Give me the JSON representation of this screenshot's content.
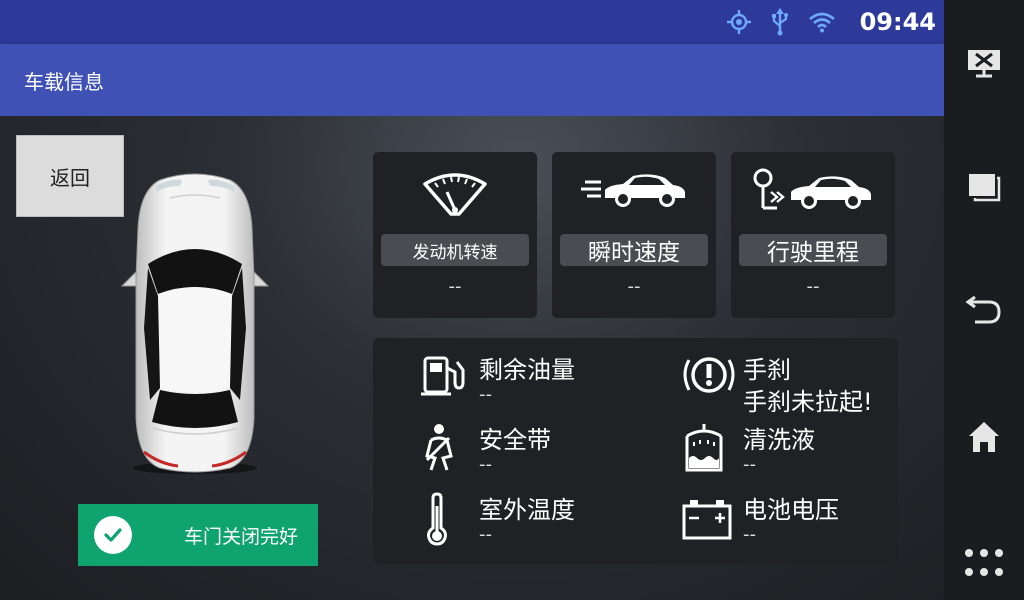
{
  "status_bar": {
    "time": "09:44",
    "icons": [
      "gps-icon",
      "usb-icon",
      "wifi-icon"
    ]
  },
  "app_bar": {
    "title": "车载信息"
  },
  "back_button": {
    "label": "返回"
  },
  "door_status": {
    "label": "车门关闭完好",
    "icon": "check-icon"
  },
  "cards": [
    {
      "label": "发动机转速",
      "value": "--",
      "icon": "tachometer-icon"
    },
    {
      "label": "瞬时速度",
      "value": "--",
      "icon": "speed-car-icon"
    },
    {
      "label": "行驶里程",
      "value": "--",
      "icon": "mileage-icon"
    }
  ],
  "info": {
    "fuel": {
      "label": "剩余油量",
      "value": "--",
      "icon": "fuel-icon"
    },
    "handbrake": {
      "label": "手刹",
      "value": "手刹未拉起!",
      "icon": "handbrake-icon"
    },
    "seatbelt": {
      "label": "安全带",
      "value": "--",
      "icon": "seatbelt-icon"
    },
    "washer": {
      "label": "清洗液",
      "value": "--",
      "icon": "washer-fluid-icon"
    },
    "temperature": {
      "label": "室外温度",
      "value": "--",
      "icon": "thermometer-icon"
    },
    "battery": {
      "label": "电池电压",
      "value": "--",
      "icon": "battery-icon"
    }
  },
  "nav_bar": {
    "icons": [
      "screen-off-icon",
      "recent-apps-icon",
      "back-icon",
      "home-icon",
      "apps-icon"
    ]
  },
  "colors": {
    "status_bar": "#2d3a9a",
    "app_bar": "#3f51b5",
    "door_ok": "#0fa36f"
  }
}
